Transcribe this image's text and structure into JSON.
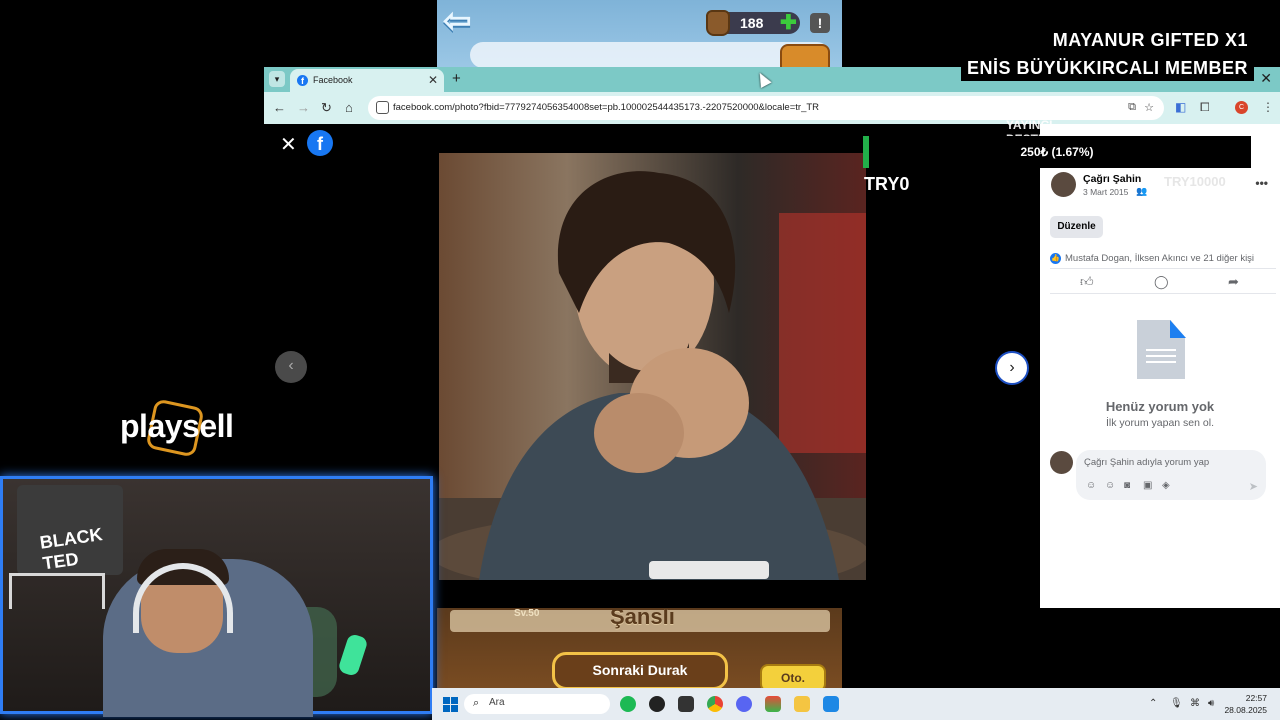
{
  "game": {
    "coins": "188",
    "level": "Sv.50",
    "lucky_label": "Şanslı",
    "next_stop_label": "Sonraki Durak",
    "auto_label": "Oto."
  },
  "stream": {
    "overlay_line1": "MAYANUR  GIFTED X1",
    "overlay_line2": "ENİS BÜYÜKKIRCALI  MEMBER",
    "brand": "playsell",
    "donation_text": "250₺ (1.67%)",
    "donation_progress_percent": 1.67,
    "try_label": "TRY0",
    "yayin_label": "YAYINCI DESTEK",
    "watermark": "TRY10000",
    "cam_logo_text": "BLACK TED"
  },
  "browser": {
    "tab_title": "Facebook",
    "url": "facebook.com/photo?fbid=7779274056354008set=pb.100002544435173.-2207520000&locale=tr_TR"
  },
  "post": {
    "author": "Çağrı Şahin",
    "date": "3 Mart 2015",
    "edit_label": "Düzenle",
    "reactions": "Mustafa Dogan, İlksen Akıncı ve 21 diğer kişi",
    "empty_title": "Henüz yorum yok",
    "empty_subtitle": "İlk yorum yapan sen ol.",
    "comment_placeholder": "Çağrı Şahin adıyla yorum yap"
  },
  "taskbar": {
    "search_placeholder": "Ara",
    "time": "22:57",
    "date": "28.08.2025"
  },
  "colors": {
    "facebook_blue": "#1877f2",
    "donation_green": "#22b04a",
    "webcam_border": "#2f7df4"
  }
}
